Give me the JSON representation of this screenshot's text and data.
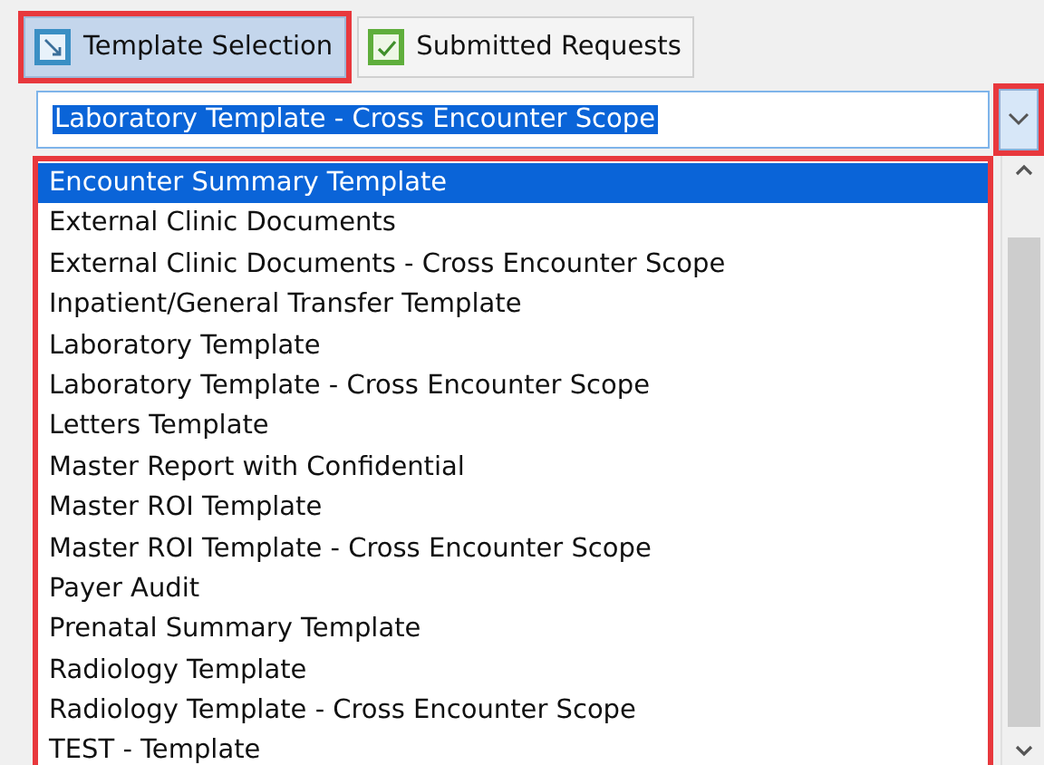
{
  "tabs": [
    {
      "label": "Template Selection",
      "kind": "template",
      "selected": true,
      "highlighted": true
    },
    {
      "label": "Submitted Requests",
      "kind": "submitted",
      "selected": false,
      "highlighted": false
    }
  ],
  "combo": {
    "value": "Laboratory Template - Cross Encounter Scope",
    "text_selected": true,
    "button_highlighted": true
  },
  "list": {
    "highlighted": true,
    "items": [
      {
        "label": "Encounter Summary Template",
        "selected": true
      },
      {
        "label": "External Clinic Documents",
        "selected": false
      },
      {
        "label": "External Clinic Documents - Cross Encounter Scope",
        "selected": false
      },
      {
        "label": "Inpatient/General Transfer Template",
        "selected": false
      },
      {
        "label": "Laboratory Template",
        "selected": false
      },
      {
        "label": "Laboratory Template - Cross Encounter Scope",
        "selected": false
      },
      {
        "label": "Letters Template",
        "selected": false
      },
      {
        "label": "Master Report with Confidential",
        "selected": false
      },
      {
        "label": "Master ROI Template",
        "selected": false
      },
      {
        "label": "Master ROI Template - Cross Encounter Scope",
        "selected": false
      },
      {
        "label": "Payer Audit",
        "selected": false
      },
      {
        "label": "Prenatal Summary Template",
        "selected": false
      },
      {
        "label": "Radiology Template",
        "selected": false
      },
      {
        "label": "Radiology Template - Cross Encounter Scope",
        "selected": false
      },
      {
        "label": "TEST - Template",
        "selected": false
      }
    ]
  }
}
